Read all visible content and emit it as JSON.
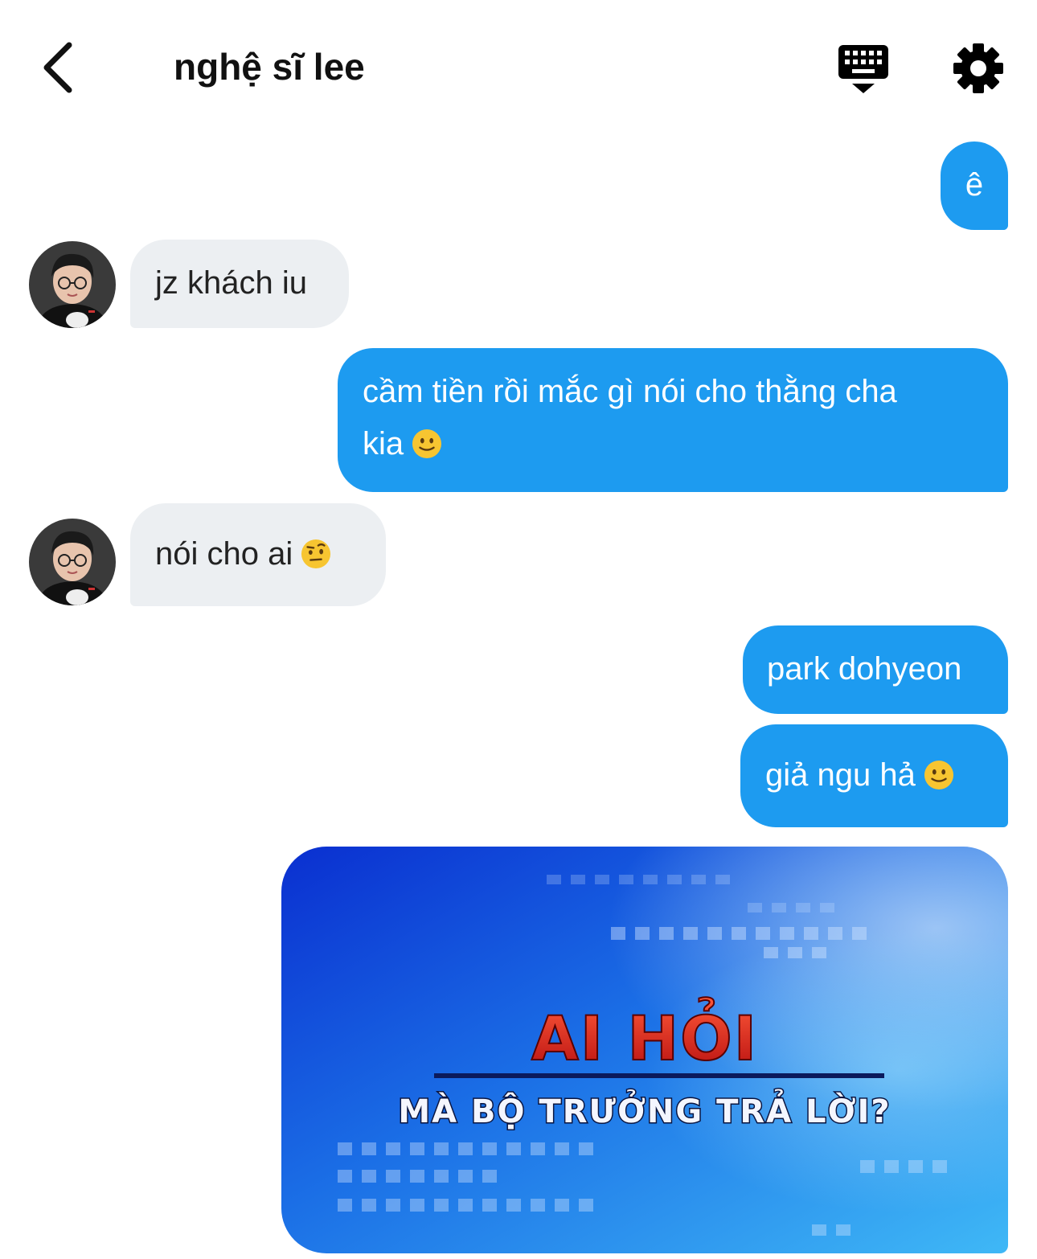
{
  "header": {
    "title": "nghệ sĩ lee",
    "back_icon": "chevron-left-icon",
    "keyboard_icon": "keyboard-icon",
    "settings_icon": "gear-icon"
  },
  "messages": [
    {
      "direction": "outgoing",
      "text": "ê"
    },
    {
      "direction": "incoming",
      "text": "jz khách iu"
    },
    {
      "direction": "outgoing",
      "line1": "cầm tiền rồi mắc gì nói cho thằng cha",
      "line2": "kia",
      "emoji": "slightly-smiling-face"
    },
    {
      "direction": "incoming",
      "text": "nói cho ai",
      "emoji": "raised-eyebrow-face"
    },
    {
      "direction": "outgoing",
      "text": "park dohyeon"
    },
    {
      "direction": "outgoing",
      "text": "giả ngu hả",
      "emoji": "slightly-smiling-face"
    },
    {
      "direction": "outgoing",
      "type": "image",
      "headline": "AI HỎI",
      "caption": "MÀ BỘ TRƯỞNG TRẢ LỜI?"
    }
  ],
  "colors": {
    "outgoing_bubble": "#1d9bf0",
    "incoming_bubble": "#eceff2",
    "emoji_yellow": "#f7c531"
  }
}
